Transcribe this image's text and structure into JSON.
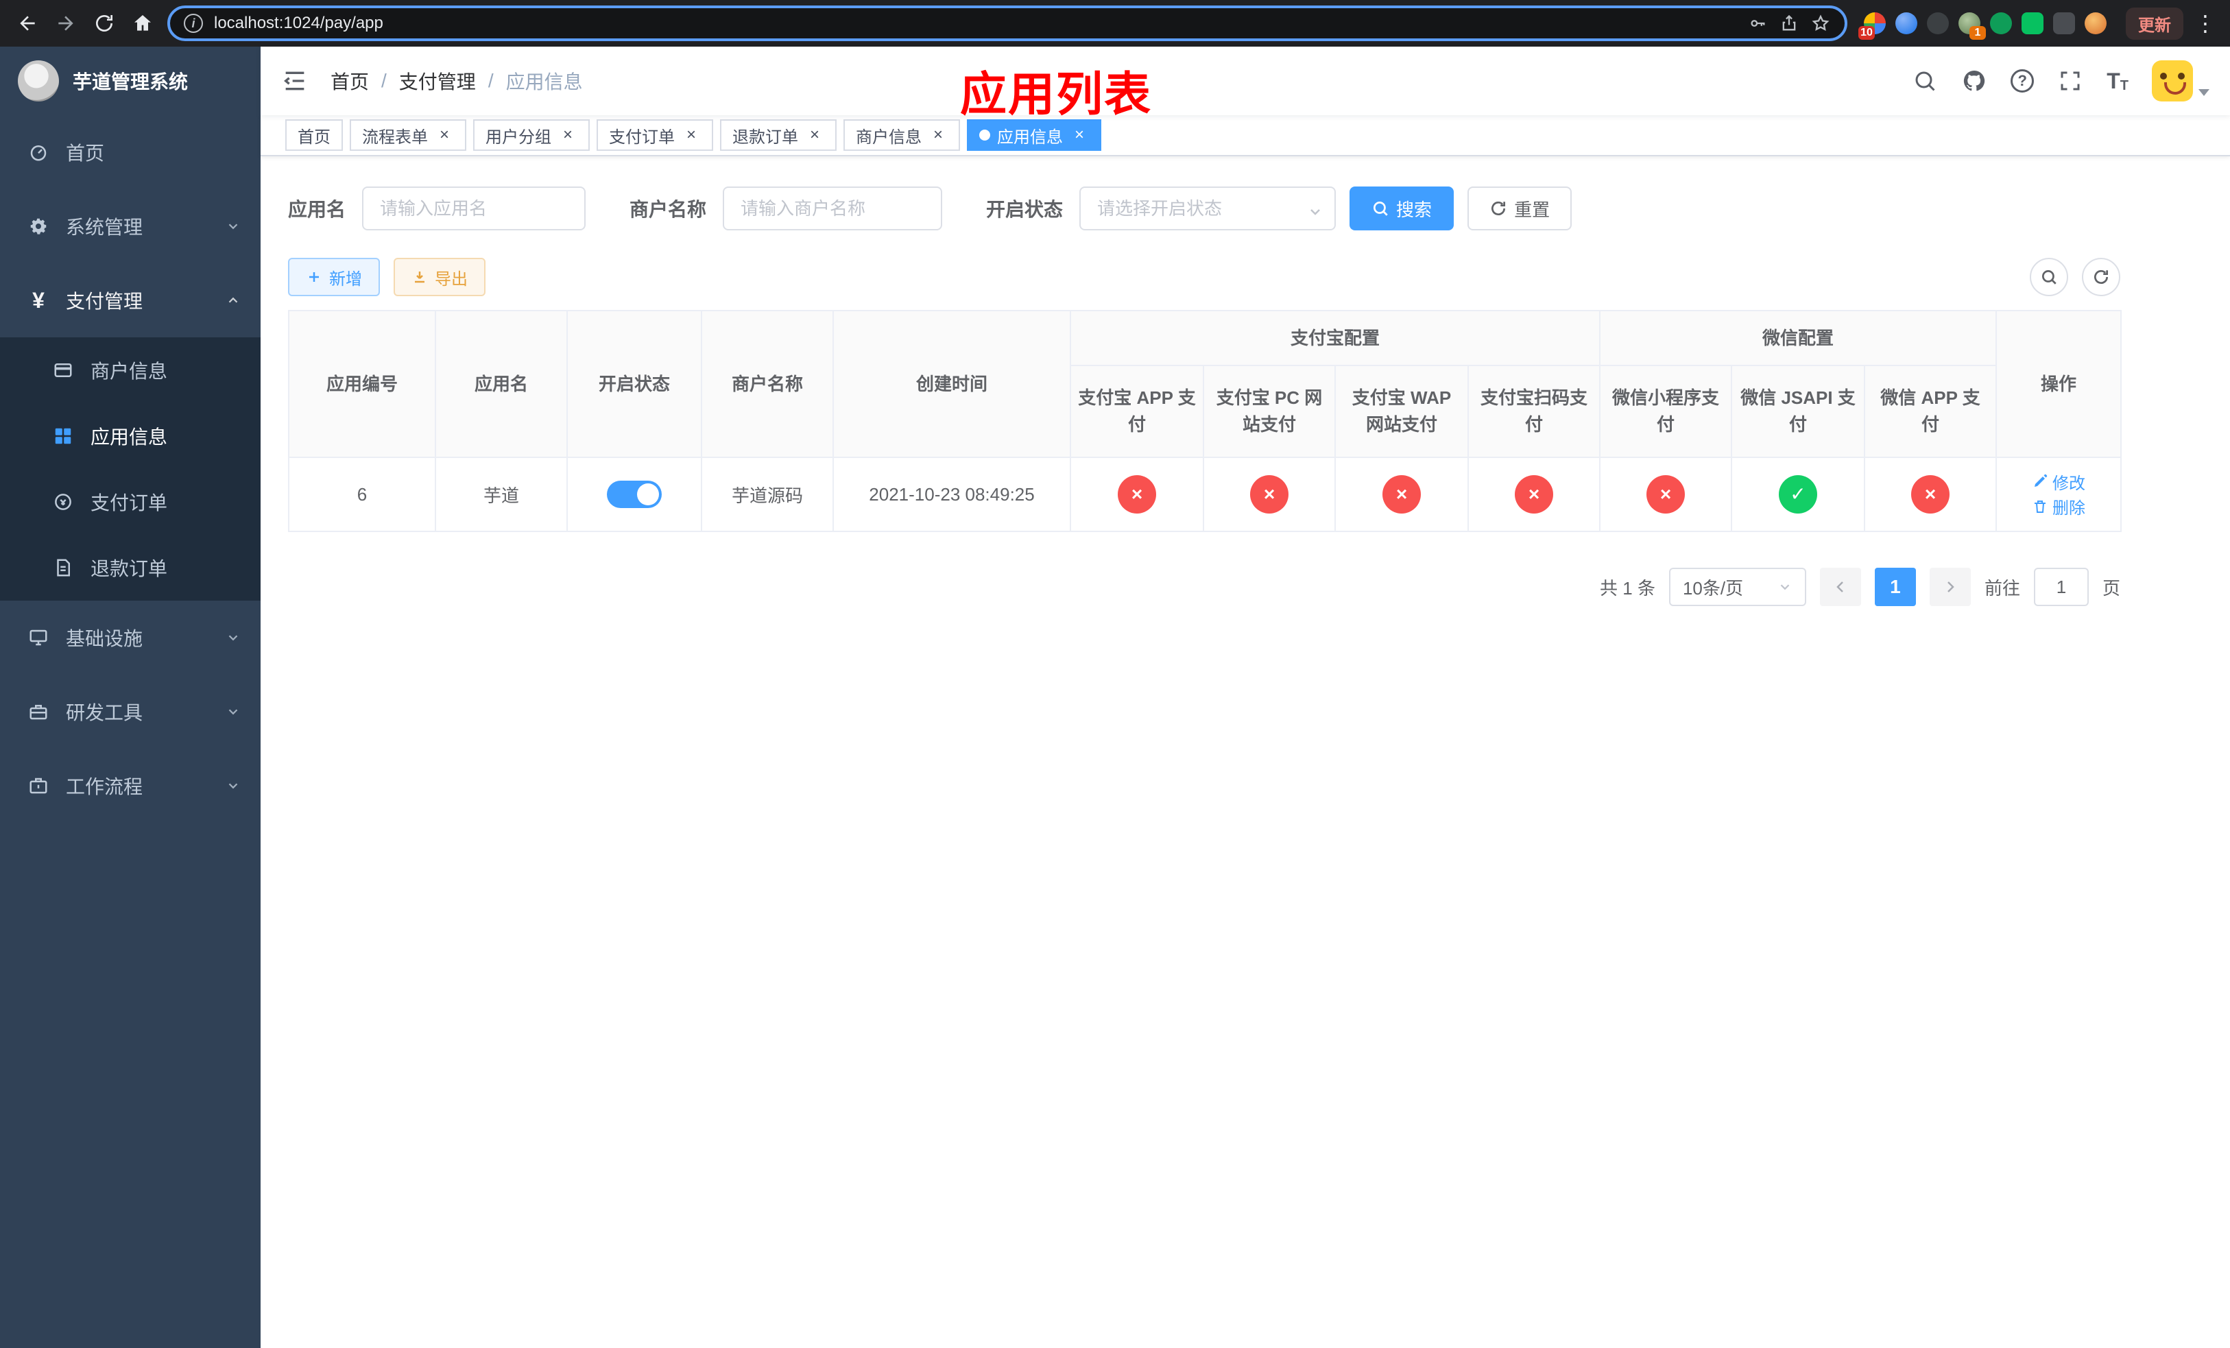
{
  "colors": {
    "accent": "#409eff",
    "status_on": "#13ce66",
    "status_off": "#f8514f",
    "annotation": "#ff0000",
    "warning": "#e6a23c",
    "sidebar_bg": "#304156",
    "submenu_bg": "#1f2d3d"
  },
  "icons": {
    "yes": "✓",
    "no": "×",
    "question": "?",
    "kebab": "⋮",
    "info": "i",
    "font_big": "T",
    "font_small": "T"
  },
  "browser": {
    "url": "localhost:1024/pay/app",
    "update_label": "更新",
    "ext_badges": {
      "extensions": "10",
      "avatar": "1"
    }
  },
  "sidebar": {
    "title": "芋道管理系统",
    "items": [
      {
        "label": "首页"
      },
      {
        "label": "系统管理"
      },
      {
        "label": "支付管理"
      },
      {
        "label": "基础设施"
      },
      {
        "label": "研发工具"
      },
      {
        "label": "工作流程"
      }
    ],
    "payment_children": [
      {
        "label": "商户信息"
      },
      {
        "label": "应用信息"
      },
      {
        "label": "支付订单"
      },
      {
        "label": "退款订单"
      }
    ]
  },
  "navbar": {
    "breadcrumb": [
      "首页",
      "支付管理",
      "应用信息"
    ],
    "annotation": "应用列表"
  },
  "tags": [
    {
      "label": "首页"
    },
    {
      "label": "流程表单"
    },
    {
      "label": "用户分组"
    },
    {
      "label": "支付订单"
    },
    {
      "label": "退款订单"
    },
    {
      "label": "商户信息"
    },
    {
      "label": "应用信息"
    }
  ],
  "filters": {
    "app_name_label": "应用名",
    "app_name_placeholder": "请输入应用名",
    "merchant_label": "商户名称",
    "merchant_placeholder": "请输入商户名称",
    "status_label": "开启状态",
    "status_placeholder": "请选择开启状态",
    "search_label": "搜索",
    "reset_label": "重置"
  },
  "toolbar": {
    "add_label": "新增",
    "export_label": "导出"
  },
  "table": {
    "headers": {
      "id": "应用编号",
      "name": "应用名",
      "status": "开启状态",
      "merchant": "商户名称",
      "created": "创建时间",
      "alipay_group": "支付宝配置",
      "wechat_group": "微信配置",
      "alipay_app": "支付宝 APP 支付",
      "alipay_pc": "支付宝 PC 网站支付",
      "alipay_wap": "支付宝 WAP 网站支付",
      "alipay_qr": "支付宝扫码支付",
      "wx_mini": "微信小程序支付",
      "wx_jsapi": "微信 JSAPI 支付",
      "wx_app": "微信 APP 支付",
      "actions": "操作"
    },
    "rows": [
      {
        "id": "6",
        "name": "芋道",
        "enabled": true,
        "merchant": "芋道源码",
        "created": "2021-10-23 08:49:25",
        "alipay_app": false,
        "alipay_pc": false,
        "alipay_wap": false,
        "alipay_qr": false,
        "wx_mini": false,
        "wx_jsapi": true,
        "wx_app": false,
        "edit_label": "修改",
        "delete_label": "删除"
      }
    ]
  },
  "pagination": {
    "total": "共 1 条",
    "page_size": "10条/页",
    "current_page": "1",
    "goto_label": "前往",
    "goto_value": "1",
    "goto_suffix": "页"
  }
}
